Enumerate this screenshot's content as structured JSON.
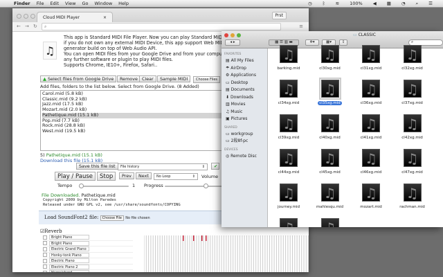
{
  "menubar": {
    "apple": "",
    "items": [
      "Finder",
      "File",
      "Edit",
      "View",
      "Go",
      "Window",
      "Help"
    ],
    "battery": "100%"
  },
  "browser": {
    "tab_title": "Cloud MIDI Player",
    "profile": "Prst"
  },
  "app": {
    "intro": [
      "This app is Standard MIDI File Player. Now you can play Standard MIDI File",
      "if you do not own any external MIDI Device, this app support Web MIDI",
      "generator build on top of Web Audio API.",
      "You can open MIDI files from your Google Drive and from your computer",
      "any further software or plugin to play MIDI files.",
      "Supports Chrome, IE10+, Firefox, Safari.."
    ],
    "buttons": {
      "drive": "Select files from Google Drive",
      "remove": "Remove",
      "clear": "Clear",
      "sample": "Sample MIDI",
      "choose": "Choose Files"
    },
    "add_hint": "Add files, folders to the list below. Select from Google Drive. (8 Added)",
    "files": [
      "Carol.mid (5.8 kB)",
      "Classic.mid (9.2 kB)",
      "Jazz.mid (17.5 kB)",
      "Mozart.mid (2.0 kB)",
      "Pathetique.mid (15.1 kB)",
      "Pop.mid (7.7 kB)",
      "Rock.mid (28.8 kB)",
      "West.mid (19.5 kB)"
    ],
    "selected_index": 4,
    "current_prefix": "5) ",
    "current_file": "Pathetique.mid (15.1 kB)",
    "download_link": "Download this file",
    "download_size": " (15.1 kB)",
    "save_list": "Save this file list",
    "history": "File history",
    "play": "Play / Pause",
    "stop": "Stop",
    "prev": "Prev",
    "next": "Next",
    "loop": "No Loop",
    "volume": "Volume",
    "tempo_label": "Tempo",
    "tempo_value": "1",
    "tempo_fraction": 0.0,
    "progress_label": "Progress",
    "progress_fraction": 0.6,
    "status_label": "File Downloaded.",
    "status_file": " Pathetique.mid",
    "copyright1": "Copyright 2009 by Milton Paredes",
    "copyright2": "Released under GNU GPL v2, see /usr/share/soundfonts/COPYING",
    "soundfont_label": "Load SoundFont2 file:",
    "soundfont_button": "Choose File",
    "soundfont_value": "No file chosen",
    "reverb": "Reverb",
    "instruments": [
      "Bright Piano",
      "Bright Piano",
      "Electric Grand Piano",
      "Honky-tonk Piano",
      "Electric Piano",
      "Electric Piano 2",
      "Harpsichord"
    ]
  },
  "finder": {
    "title": "CLASSIC",
    "sidebar": {
      "favorites_header": "FAVORITES",
      "favorites": [
        "All My Files",
        "AirDrop",
        "Applications",
        "Desktop",
        "Documents",
        "Downloads",
        "Movies",
        "Music",
        "Pictures"
      ],
      "shared_header": "SHARED",
      "shared": [
        "workgroup",
        "2段8f-pc"
      ],
      "devices_header": "DEVICES",
      "devices": [
        "Remote Disc"
      ]
    },
    "files": [
      "barking.mid",
      "cl30xg.mid",
      "cl31xg.mid",
      "cl32xg.mid",
      "cl34xg.mid",
      "cl35xg.mid",
      "cl36xg.mid",
      "cl37xg.mid",
      "cl39xg.mid",
      "cl40xg.mid",
      "cl41xg.mid",
      "cl42xg.mid",
      "cl44xg.mid",
      "cl45xg.mid",
      "cl46xg.mid",
      "cl47xg.mid",
      "journey.mid",
      "mahlesqu.mid",
      "mozart.mid",
      "rachman.mid",
      "",
      ""
    ],
    "selected": "cl35xg.mid"
  }
}
